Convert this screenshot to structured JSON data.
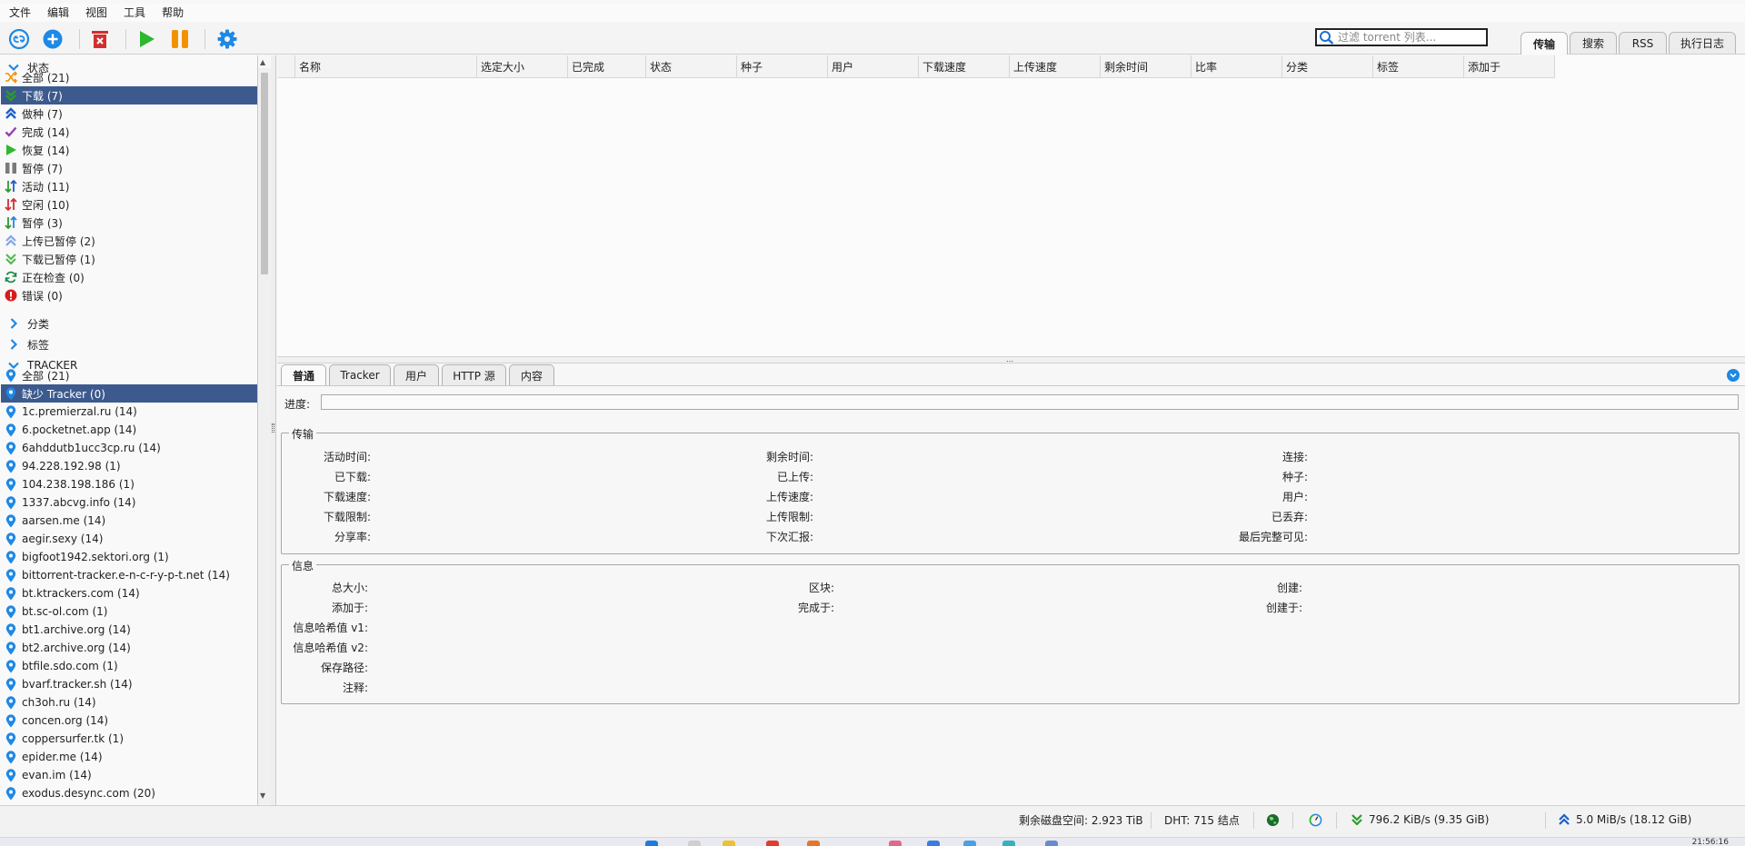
{
  "menu": [
    "文件",
    "编辑",
    "视图",
    "工具",
    "帮助"
  ],
  "toolbar": {
    "icons": [
      "link-icon",
      "add-icon",
      "delete-icon",
      "resume-icon",
      "pause-icon",
      "gear-icon"
    ],
    "search_placeholder": "过滤 torrent 列表..."
  },
  "top_tabs": [
    {
      "label": "传输",
      "active": true
    },
    {
      "label": "搜索",
      "active": false
    },
    {
      "label": "RSS",
      "active": false
    },
    {
      "label": "执行日志",
      "active": false
    }
  ],
  "sidebar": {
    "status_header": "状态",
    "status_items": [
      {
        "label": "全部 (21)",
        "icon": "shuffle-icon",
        "selected": false
      },
      {
        "label": "下载 (7)",
        "icon": "download-icon",
        "selected": true
      },
      {
        "label": "做种 (7)",
        "icon": "upload-icon",
        "selected": false
      },
      {
        "label": "完成 (14)",
        "icon": "check-icon",
        "selected": false
      },
      {
        "label": "恢复 (14)",
        "icon": "play-icon",
        "selected": false
      },
      {
        "label": "暂停 (7)",
        "icon": "pause-icon",
        "selected": false
      },
      {
        "label": "活动 (11)",
        "icon": "active-arrows-icon",
        "selected": false
      },
      {
        "label": "空闲 (10)",
        "icon": "inactive-arrows-icon",
        "selected": false
      },
      {
        "label": "暂停 (3)",
        "icon": "stalled-arrows-icon",
        "selected": false
      },
      {
        "label": "上传已暂停 (2)",
        "icon": "upload-stalled-icon",
        "selected": false
      },
      {
        "label": "下载已暂停 (1)",
        "icon": "download-stalled-icon",
        "selected": false
      },
      {
        "label": "正在检查 (0)",
        "icon": "refresh-icon",
        "selected": false
      },
      {
        "label": "错误 (0)",
        "icon": "error-icon",
        "selected": false
      }
    ],
    "category_header": "分类",
    "tag_header": "标签",
    "tracker_header": "TRACKER",
    "tracker_items": [
      {
        "label": "全部 (21)",
        "selected": false
      },
      {
        "label": "缺少 Tracker (0)",
        "selected": true
      },
      {
        "label": "1c.premierzal.ru (14)",
        "selected": false
      },
      {
        "label": "6.pocketnet.app (14)",
        "selected": false
      },
      {
        "label": "6ahddutb1ucc3cp.ru (14)",
        "selected": false
      },
      {
        "label": "94.228.192.98 (1)",
        "selected": false
      },
      {
        "label": "104.238.198.186 (1)",
        "selected": false
      },
      {
        "label": "1337.abcvg.info (14)",
        "selected": false
      },
      {
        "label": "aarsen.me (14)",
        "selected": false
      },
      {
        "label": "aegir.sexy (14)",
        "selected": false
      },
      {
        "label": "bigfoot1942.sektori.org (1)",
        "selected": false
      },
      {
        "label": "bittorrent-tracker.e-n-c-r-y-p-t.net (14)",
        "selected": false
      },
      {
        "label": "bt.ktrackers.com (14)",
        "selected": false
      },
      {
        "label": "bt.sc-ol.com (1)",
        "selected": false
      },
      {
        "label": "bt1.archive.org (14)",
        "selected": false
      },
      {
        "label": "bt2.archive.org (14)",
        "selected": false
      },
      {
        "label": "btfile.sdo.com (1)",
        "selected": false
      },
      {
        "label": "bvarf.tracker.sh (14)",
        "selected": false
      },
      {
        "label": "ch3oh.ru (14)",
        "selected": false
      },
      {
        "label": "concen.org (14)",
        "selected": false
      },
      {
        "label": "coppersurfer.tk (1)",
        "selected": false
      },
      {
        "label": "epider.me (14)",
        "selected": false
      },
      {
        "label": "evan.im (14)",
        "selected": false
      },
      {
        "label": "exodus.desync.com (20)",
        "selected": false
      }
    ]
  },
  "columns": [
    "名称",
    "选定大小",
    "已完成",
    "状态",
    "种子",
    "用户",
    "下载速度",
    "上传速度",
    "剩余时间",
    "比率",
    "分类",
    "标签",
    "添加于"
  ],
  "detail_tabs": [
    {
      "label": "普通",
      "active": true
    },
    {
      "label": "Tracker",
      "active": false
    },
    {
      "label": "用户",
      "active": false
    },
    {
      "label": "HTTP 源",
      "active": false
    },
    {
      "label": "内容",
      "active": false
    }
  ],
  "progress_label": "进度:",
  "transfer": {
    "title": "传输",
    "col1": [
      "活动时间:",
      "已下载:",
      "下载速度:",
      "下载限制:",
      "分享率:"
    ],
    "col2": [
      "剩余时间:",
      "已上传:",
      "上传速度:",
      "上传限制:",
      "下次汇报:"
    ],
    "col3": [
      "连接:",
      "种子:",
      "用户:",
      "已丢弃:",
      "最后完整可见:"
    ]
  },
  "info": {
    "title": "信息",
    "col1": [
      "总大小:",
      "添加于:",
      "信息哈希值 v1:",
      "信息哈希值 v2:",
      "保存路径:",
      "注释:"
    ],
    "col2": [
      "区块:",
      "完成于:"
    ],
    "col3": [
      "创建:",
      "创建于:"
    ]
  },
  "status_bar": {
    "free_space": "剩余磁盘空间:  2.923 TiB",
    "dht": "DHT:  715 结点",
    "download": "796.2 KiB/s (9.35 GiB)",
    "upload": "5.0 MiB/s (18.12 GiB)"
  },
  "clock": "21:56:16",
  "colors": {
    "selection": "#3c5a8e",
    "accent_blue": "#1e88e5",
    "green": "#2e9a2e",
    "orange": "#f39200",
    "red": "#d32f2f"
  }
}
